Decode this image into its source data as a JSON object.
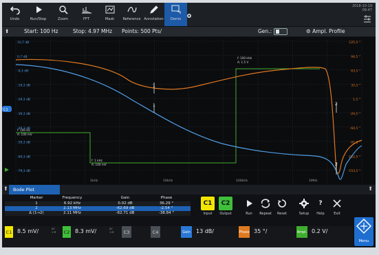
{
  "toolbar": {
    "buttons": [
      {
        "label": "Undo",
        "icon": "undo-icon"
      },
      {
        "label": "Run/Stop",
        "icon": "play-icon"
      },
      {
        "label": "Zoom",
        "icon": "zoom-icon"
      },
      {
        "label": "FFT",
        "icon": "fft-icon"
      },
      {
        "label": "Mask",
        "icon": "mask-icon"
      },
      {
        "label": "Reference",
        "icon": "reference-icon"
      },
      {
        "label": "Annotation",
        "icon": "pen-icon"
      },
      {
        "label": "Demo",
        "icon": "demo-icon"
      }
    ],
    "datetime": [
      "2018-10-19",
      "09:47"
    ]
  },
  "settings": {
    "start": "Start: 100 Hz",
    "stop": "Stop: 4.97 MHz",
    "points": "Points: 500 Pts/",
    "gen": "Gen.:",
    "profile": "Ampl. Profile"
  },
  "plot": {
    "left_labels": [
      "10,7 dB",
      "0,7 dB",
      "-9,3 dB",
      "-19,3 dB",
      "-29,3 dB",
      "-39,3 dB",
      "-49,3 dB",
      "-59,3 dB",
      "-69,3 dB",
      "-79,3 dB"
    ],
    "right_labels": [
      "125,5 °",
      "94,5 °",
      "63,5 °",
      "32,5 °",
      "1,5 °",
      "-29,5 °",
      "-60,5 °",
      "-91,5 °",
      "-122,5 °",
      "-153,5 °"
    ],
    "x_labels": [
      "1kHz",
      "10kHz",
      "100kHz",
      "1MHz"
    ],
    "markers": [
      "1",
      "1",
      "2",
      "2"
    ],
    "ch_marker": "C1",
    "annotations": {
      "a1_line1": "f: 100 Hz",
      "a1_line2": "A: 100 mV",
      "a2_line1": "f: 1 kHz",
      "a2_line2": "A: 100 mV",
      "a3_line1": "f: 100 kHz",
      "a3_line2": "A: 1.5 V"
    },
    "colors": {
      "gain": "#4f9fe8",
      "phase": "#e07a20",
      "amplitude": "#3fae2e"
    }
  },
  "bode": {
    "tab": "Bode Plot",
    "headers": [
      "Marker",
      "Frequency",
      "Gain",
      "Phase"
    ],
    "rows": [
      [
        "1",
        "6.92 kHz",
        "0.02 dB",
        "36.29 °"
      ],
      [
        "2",
        "2.13 MHz",
        "-62.69 dB",
        "-2.54 °"
      ],
      [
        "Δ (1→2)",
        "2.11 MHz",
        "-62.71 dB",
        "-38.84 °"
      ]
    ]
  },
  "controls": {
    "input": {
      "key": "C1",
      "label": "Input"
    },
    "output": {
      "key": "C2",
      "label": "Output"
    },
    "run": "Run",
    "repeat": "Repeat",
    "reset": "Reset",
    "setup": "Setup",
    "help": "Help",
    "exit": "Exit",
    "menu": "Menu"
  },
  "channels": [
    {
      "key": "C1",
      "value": "8.5 mV/",
      "color": "#f2e600",
      "coupling": [
        "AC",
        "1 M"
      ]
    },
    {
      "key": "C2",
      "value": "8.3 mV/",
      "color": "#3fbf3a",
      "coupling": [
        "AC",
        "1 M"
      ]
    },
    {
      "key": "C3",
      "value": "",
      "color": "#4a4f55",
      "coupling": []
    },
    {
      "key": "C4",
      "value": "",
      "color": "#4a4f55",
      "coupling": []
    },
    {
      "key": "Gain",
      "value": "13 dB/",
      "color": "#2a78d6",
      "coupling": []
    },
    {
      "key": "Phase",
      "value": "35 °/",
      "color": "#e07a20",
      "coupling": []
    },
    {
      "key": "Ampl.",
      "value": "0.2 V/",
      "color": "#3fae2e",
      "coupling": []
    }
  ]
}
